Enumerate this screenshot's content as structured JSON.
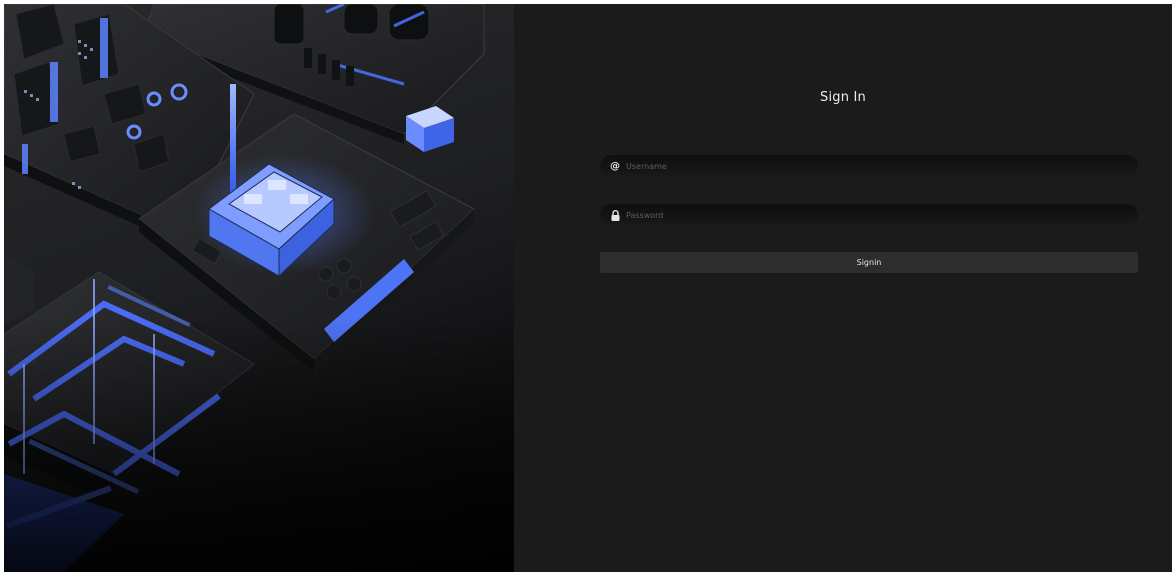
{
  "signin": {
    "title": "Sign In",
    "username": {
      "placeholder": "Username",
      "value": "",
      "icon": "at-icon"
    },
    "password": {
      "placeholder": "Password",
      "value": "",
      "icon": "lock-icon"
    },
    "submit_label": "Signin"
  },
  "hero": {
    "description_icon": "industrial-city-illustration"
  },
  "colors": {
    "panel_bg": "#1b1b1c",
    "field_bg": "#141415",
    "button_bg": "#2d2d2e",
    "accent_glow": "#3b6cff",
    "text": "#ececec"
  }
}
